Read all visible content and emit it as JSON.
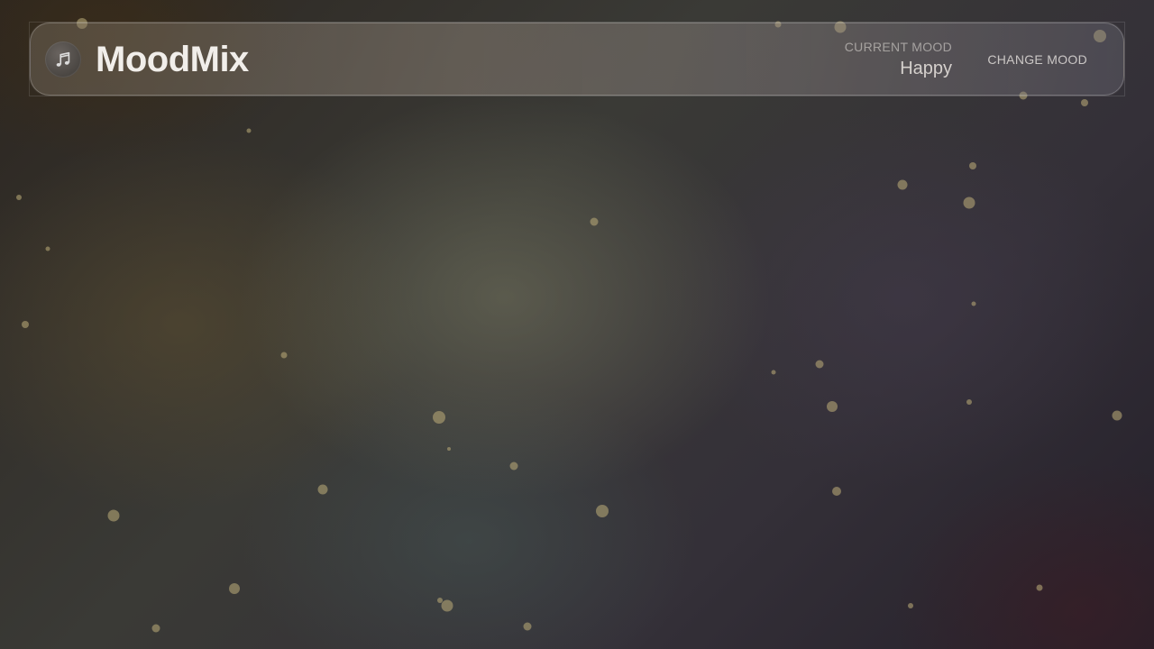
{
  "app": {
    "title": "MoodMix",
    "logo_icon": "music-note-icon"
  },
  "mood": {
    "caption": "CURRENT MOOD",
    "value": "Happy"
  },
  "actions": {
    "change_mood_label": "CHANGE MOOD"
  },
  "colors": {
    "particle": "#b4a574"
  }
}
